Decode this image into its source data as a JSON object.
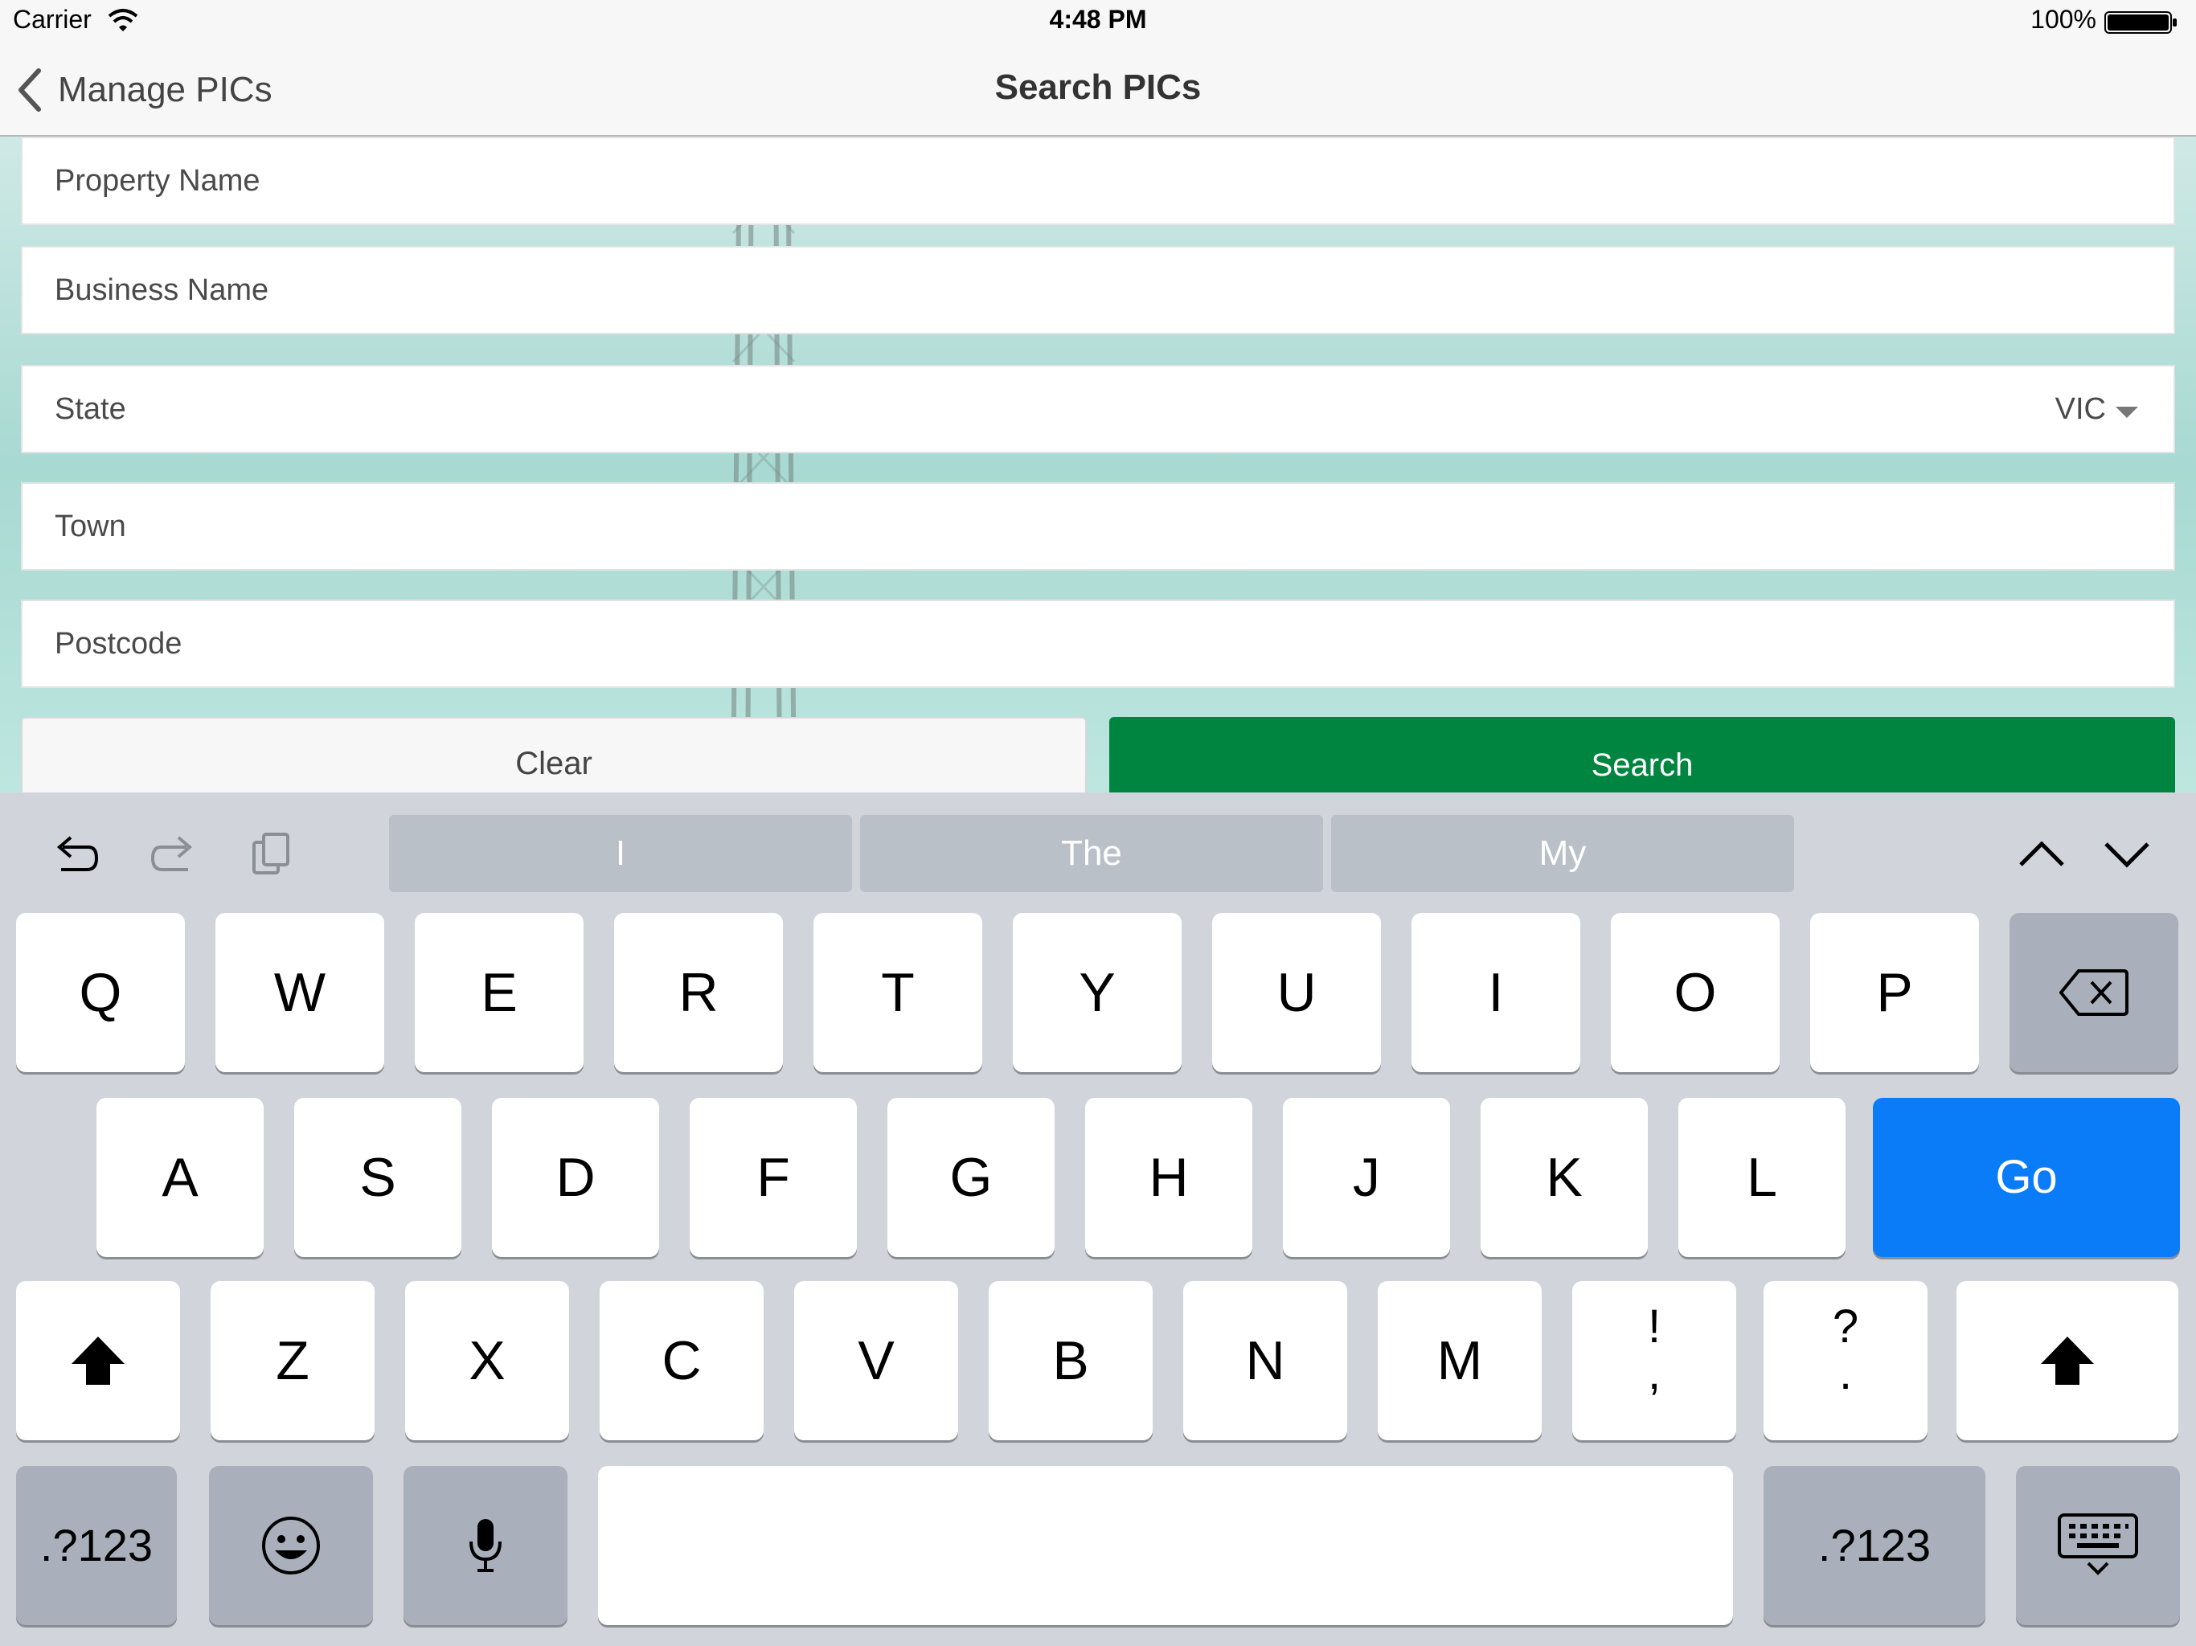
{
  "status_bar": {
    "carrier": "Carrier",
    "time": "4:48 PM",
    "battery": "100%"
  },
  "nav": {
    "back_label": "Manage PICs",
    "title": "Search PICs"
  },
  "form": {
    "property_name_placeholder": "Property Name",
    "business_name_placeholder": "Business Name",
    "state_label": "State",
    "state_value": "VIC",
    "town_placeholder": "Town",
    "postcode_placeholder": "Postcode",
    "clear_label": "Clear",
    "search_label": "Search"
  },
  "colors": {
    "search_button": "#008540",
    "go_key": "#0a7cf7",
    "keyboard_bg": "#d1d5db"
  },
  "keyboard": {
    "suggestions": [
      "I",
      "The",
      "My"
    ],
    "row1": [
      "Q",
      "W",
      "E",
      "R",
      "T",
      "Y",
      "U",
      "I",
      "O",
      "P"
    ],
    "row2": [
      "A",
      "S",
      "D",
      "F",
      "G",
      "H",
      "J",
      "K",
      "L"
    ],
    "row3": [
      "Z",
      "X",
      "C",
      "V",
      "B",
      "N",
      "M"
    ],
    "punct1": {
      "top": "!",
      "bottom": ","
    },
    "punct2": {
      "top": "?",
      "bottom": "."
    },
    "go_label": "Go",
    "numbers_label": ".?123",
    "icons": [
      "undo-icon",
      "redo-icon",
      "paste-icon",
      "chevron-up-icon",
      "chevron-down-icon",
      "backspace-icon",
      "shift-icon",
      "emoji-icon",
      "microphone-icon",
      "keyboard-dismiss-icon"
    ]
  }
}
